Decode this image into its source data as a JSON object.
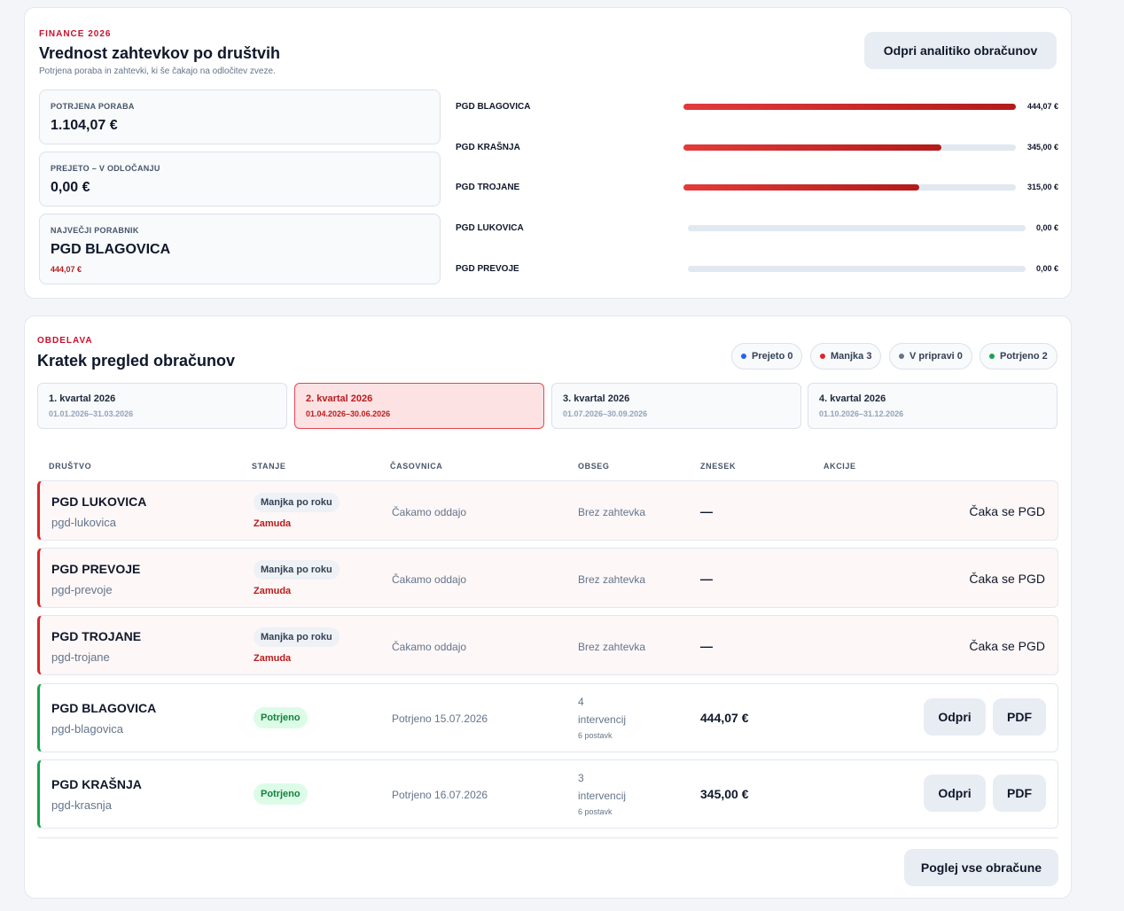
{
  "finance": {
    "kicker": "FINANCE 2026",
    "title": "Vrednost zahtevkov po društvih",
    "subtitle": "Potrjena poraba in zahtevki, ki še čakajo na odločitev zveze.",
    "open_button": "Odpri analitiko obračunov",
    "stats": [
      {
        "label": "POTRJENA PORABA",
        "value": "1.104,07 €"
      },
      {
        "label": "PREJETO – V ODLOČANJU",
        "value": "0,00 €"
      },
      {
        "label": "NAJVEČJI PORABNIK",
        "value": "PGD BLAGOVICA",
        "sub": "444,07 €"
      }
    ]
  },
  "chart_data": {
    "type": "bar",
    "orientation": "horizontal",
    "categories": [
      "PGD BLAGOVICA",
      "PGD KRAŠNJA",
      "PGD TROJANE",
      "PGD LUKOVICA",
      "PGD PREVOJE"
    ],
    "values": [
      444.07,
      345.0,
      315.0,
      0.0,
      0.0
    ],
    "value_labels": [
      "444,07 €",
      "345,00 €",
      "315,00 €",
      "0,00 €",
      "0,00 €"
    ],
    "unit": "€",
    "colors": {
      "fill": "#dc2626",
      "track": "#e2e8f0"
    }
  },
  "obdelava": {
    "kicker": "OBDELAVA",
    "title": "Kratek pregled obračunov",
    "legend": [
      {
        "label": "Prejeto 0",
        "color": "#2563eb"
      },
      {
        "label": "Manjka 3",
        "color": "#dc2626"
      },
      {
        "label": "V pripravi 0",
        "color": "#64748b"
      },
      {
        "label": "Potrjeno 2",
        "color": "#16a34a"
      }
    ],
    "quarters": [
      {
        "title": "1. kvartal 2026",
        "range": "01.01.2026–31.03.2026",
        "active": false
      },
      {
        "title": "2. kvartal 2026",
        "range": "01.04.2026–30.06.2026",
        "active": true
      },
      {
        "title": "3. kvartal 2026",
        "range": "01.07.2026–30.09.2026",
        "active": false
      },
      {
        "title": "4. kvartal 2026",
        "range": "01.10.2026–31.12.2026",
        "active": false
      }
    ],
    "columns": {
      "drustvo": "DRUŠTVO",
      "stanje": "STANJE",
      "casovnica": "ČASOVNICA",
      "obseg": "OBSEG",
      "znesek": "ZNESEK",
      "akcije": "AKCIJE"
    },
    "rows": [
      {
        "name": "PGD LUKOVICA",
        "slug": "pgd-lukovica",
        "status": "Manjka po roku",
        "late": "Zamuda",
        "time": "Čakamo oddajo",
        "scope": "Brez zahtevka",
        "amount": "—",
        "action": "Čaka se PGD"
      },
      {
        "name": "PGD PREVOJE",
        "slug": "pgd-prevoje",
        "status": "Manjka po roku",
        "late": "Zamuda",
        "time": "Čakamo oddajo",
        "scope": "Brez zahtevka",
        "amount": "—",
        "action": "Čaka se PGD"
      },
      {
        "name": "PGD TROJANE",
        "slug": "pgd-trojane",
        "status": "Manjka po roku",
        "late": "Zamuda",
        "time": "Čakamo oddajo",
        "scope": "Brez zahtevka",
        "amount": "—",
        "action": "Čaka se PGD"
      },
      {
        "name": "PGD BLAGOVICA",
        "slug": "pgd-blagovica",
        "status": "Potrjeno",
        "time": "Potrjeno 15.07.2026",
        "scope_count": "4",
        "scope_unit": "intervencij",
        "scope_items": "6 postavk",
        "amount": "444,07 €",
        "btn_open": "Odpri",
        "btn_pdf": "PDF"
      },
      {
        "name": "PGD KRAŠNJA",
        "slug": "pgd-krasnja",
        "status": "Potrjeno",
        "time": "Potrjeno 16.07.2026",
        "scope_count": "3",
        "scope_unit": "intervencij",
        "scope_items": "6 postavk",
        "amount": "345,00 €",
        "btn_open": "Odpri",
        "btn_pdf": "PDF"
      }
    ],
    "view_all": "Poglej vse obračune"
  }
}
